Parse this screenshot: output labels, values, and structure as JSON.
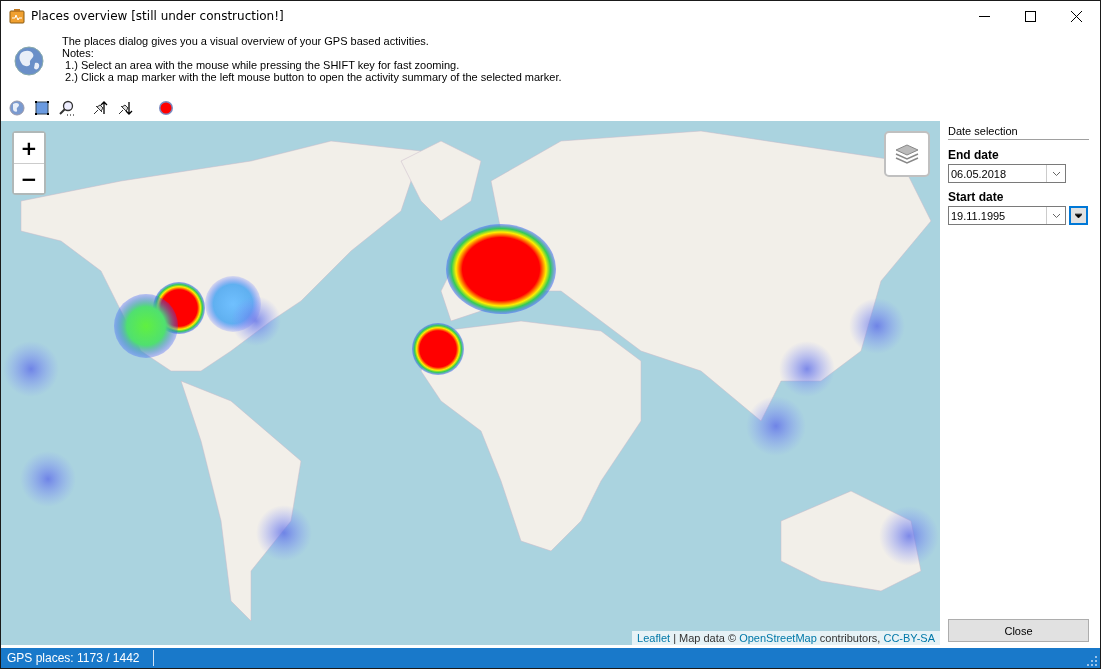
{
  "window": {
    "title": "Places overview [still under construction!]"
  },
  "header": {
    "lines": [
      "The places dialog gives you a visual overview of your GPS based activities.",
      "Notes:",
      " 1.) Select an area with the mouse while pressing the SHIFT key for fast zooming.",
      " 2.) Click a map marker with the left mouse button to open the activity summary of the selected marker."
    ]
  },
  "toolbar": [
    {
      "kind": "globe"
    },
    {
      "kind": "select"
    },
    {
      "kind": "zoom"
    },
    {
      "kind": "pin-up"
    },
    {
      "kind": "pin-down"
    },
    {
      "kind": "record"
    }
  ],
  "map": {
    "zoom_in": "+",
    "zoom_out": "−",
    "attribution": [
      {
        "kind": "link",
        "text": "Leaflet"
      },
      {
        "kind": "text",
        "text": " | Map data © "
      },
      {
        "kind": "link",
        "text": "OpenStreetMap"
      },
      {
        "kind": "text",
        "text": " contributors, "
      },
      {
        "kind": "link",
        "text": "CC-BY-SA"
      }
    ]
  },
  "date_selection": {
    "title": "Date selection",
    "fields": [
      {
        "label": "End date",
        "value": "06.05.2018",
        "extra_button": false
      },
      {
        "label": "Start date",
        "value": "19.11.1995",
        "extra_button": true
      }
    ]
  },
  "buttons": [
    "Close"
  ],
  "status_bar": {
    "text": "GPS places: 1173 / 1442"
  }
}
